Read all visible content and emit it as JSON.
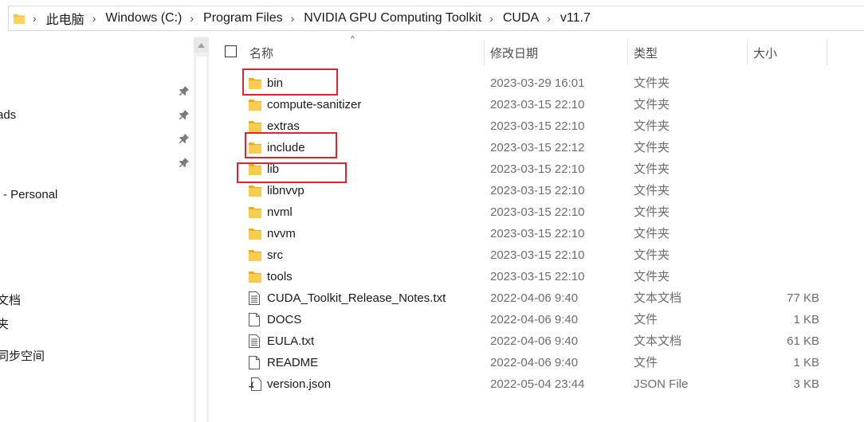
{
  "address_bar": {
    "segments": [
      "此电脑",
      "Windows (C:)",
      "Program Files",
      "NVIDIA GPU Computing Toolkit",
      "CUDA",
      "v11.7"
    ]
  },
  "nav_pane": {
    "items": [
      {
        "label": "ads",
        "pinned": true
      },
      {
        "label": "- Personal",
        "pinned": false
      },
      {
        "label": "文档",
        "pinned": false
      },
      {
        "label": "夹",
        "pinned": false
      },
      {
        "label": "同步空间",
        "pinned": false
      }
    ]
  },
  "columns": {
    "name": "名称",
    "modified": "修改日期",
    "type": "类型",
    "size": "大小"
  },
  "files": [
    {
      "name": "bin",
      "modified": "2023-03-29 16:01",
      "type": "文件夹",
      "size": "",
      "icon": "folder-icon",
      "highlighted": true
    },
    {
      "name": "compute-sanitizer",
      "modified": "2023-03-15 22:10",
      "type": "文件夹",
      "size": "",
      "icon": "folder-icon",
      "highlighted": false
    },
    {
      "name": "extras",
      "modified": "2023-03-15 22:10",
      "type": "文件夹",
      "size": "",
      "icon": "folder-icon",
      "highlighted": false
    },
    {
      "name": "include",
      "modified": "2023-03-15 22:12",
      "type": "文件夹",
      "size": "",
      "icon": "folder-icon",
      "highlighted": true
    },
    {
      "name": "lib",
      "modified": "2023-03-15 22:10",
      "type": "文件夹",
      "size": "",
      "icon": "folder-icon",
      "highlighted": true
    },
    {
      "name": "libnvvp",
      "modified": "2023-03-15 22:10",
      "type": "文件夹",
      "size": "",
      "icon": "folder-icon",
      "highlighted": false
    },
    {
      "name": "nvml",
      "modified": "2023-03-15 22:10",
      "type": "文件夹",
      "size": "",
      "icon": "folder-icon",
      "highlighted": false
    },
    {
      "name": "nvvm",
      "modified": "2023-03-15 22:10",
      "type": "文件夹",
      "size": "",
      "icon": "folder-icon",
      "highlighted": false
    },
    {
      "name": "src",
      "modified": "2023-03-15 22:10",
      "type": "文件夹",
      "size": "",
      "icon": "folder-icon",
      "highlighted": false
    },
    {
      "name": "tools",
      "modified": "2023-03-15 22:10",
      "type": "文件夹",
      "size": "",
      "icon": "folder-icon",
      "highlighted": false
    },
    {
      "name": "CUDA_Toolkit_Release_Notes.txt",
      "modified": "2022-04-06 9:40",
      "type": "文本文档",
      "size": "77 KB",
      "icon": "text-file-icon",
      "highlighted": false
    },
    {
      "name": "DOCS",
      "modified": "2022-04-06 9:40",
      "type": "文件",
      "size": "1 KB",
      "icon": "file-icon",
      "highlighted": false
    },
    {
      "name": "EULA.txt",
      "modified": "2022-04-06 9:40",
      "type": "文本文档",
      "size": "61 KB",
      "icon": "text-file-icon",
      "highlighted": false
    },
    {
      "name": "README",
      "modified": "2022-04-06 9:40",
      "type": "文件",
      "size": "1 KB",
      "icon": "file-icon",
      "highlighted": false
    },
    {
      "name": "version.json",
      "modified": "2022-05-04 23:44",
      "type": "JSON File",
      "size": "3 KB",
      "icon": "json-file-icon",
      "highlighted": false
    }
  ],
  "colors": {
    "folder": "#f5c33b",
    "highlight_box": "#e0242f",
    "secondary_text": "#6d6d6d"
  }
}
